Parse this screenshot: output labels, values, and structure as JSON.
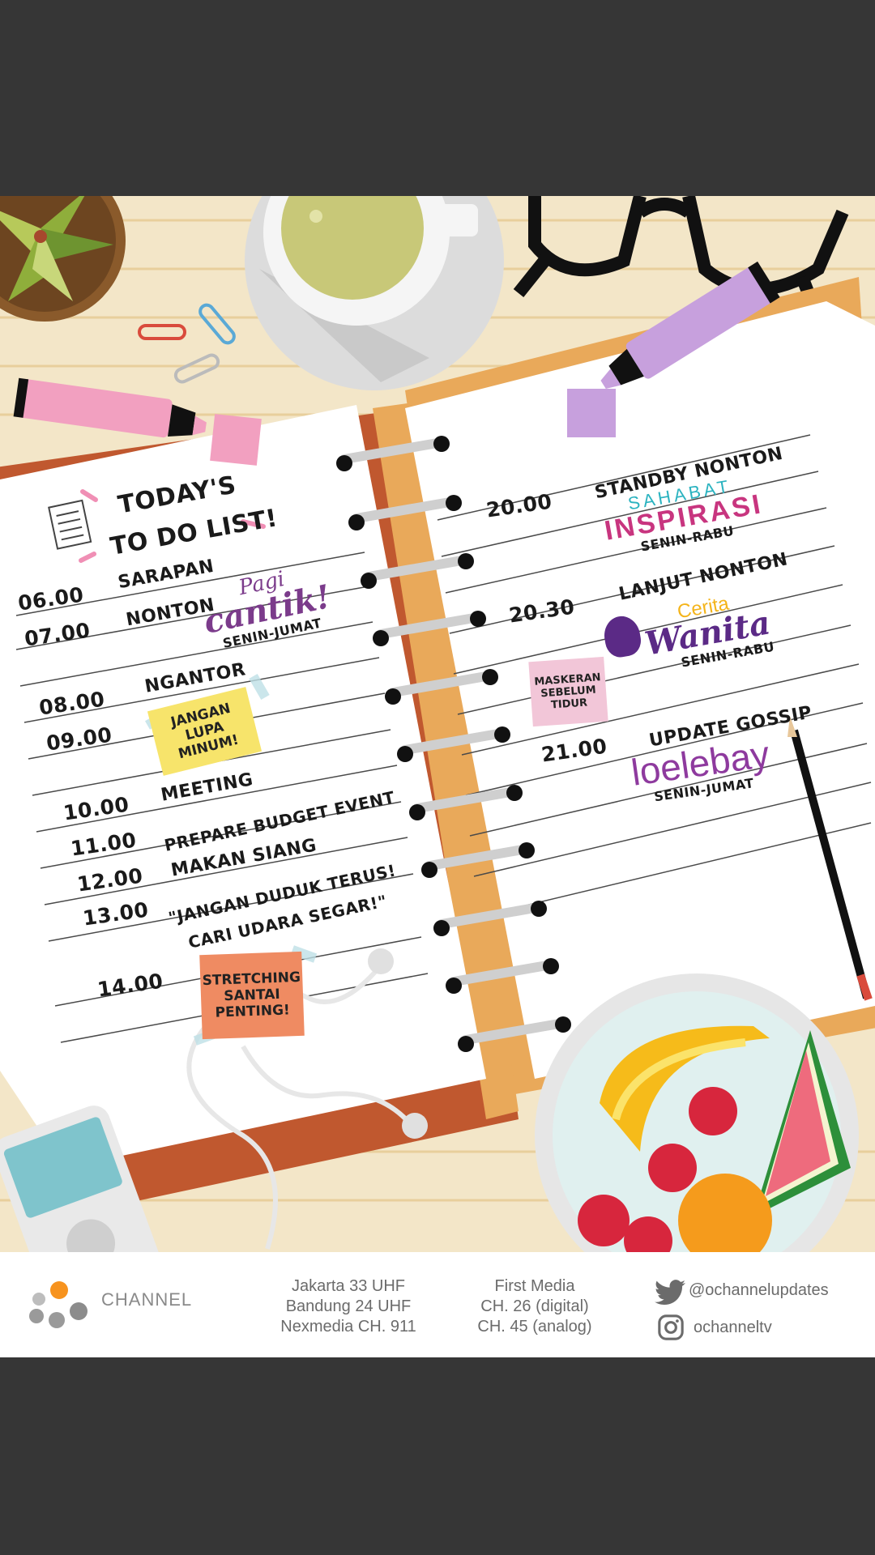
{
  "left_page": {
    "title_line1": "TODAY'S",
    "title_line2": "TO DO LIST!",
    "entries": [
      {
        "time": "06.00",
        "task": "SARAPAN"
      },
      {
        "time": "07.00",
        "task": "NONTON"
      },
      {
        "time": "08.00",
        "task": "NGANTOR"
      },
      {
        "time": "09.00",
        "task": ""
      },
      {
        "time": "10.00",
        "task": "MEETING"
      },
      {
        "time": "11.00",
        "task": "PREPARE BUDGET EVENT"
      },
      {
        "time": "12.00",
        "task": "MAKAN SIANG"
      },
      {
        "time": "13.00",
        "task": "\"JANGAN DUDUK TERUS!"
      },
      {
        "time": "",
        "task": "CARI UDARA SEGAR!\""
      },
      {
        "time": "14.00",
        "task": ""
      }
    ],
    "show_pagi_cantik": {
      "line1": "Pagi",
      "line2": "cantik!",
      "schedule": "SENIN-JUMAT"
    },
    "sticky_yellow": "JANGAN LUPA\nMINUM!",
    "sticky_orange": "STRETCHING\nSANTAI\nPENTING!"
  },
  "right_page": {
    "entries": [
      {
        "time": "20.00",
        "task": "STANDBY NONTON"
      },
      {
        "time": "20.30",
        "task": "LANJUT NONTON"
      },
      {
        "time": "21.00",
        "task": "UPDATE GOSSIP"
      }
    ],
    "show_sahabat": {
      "line1": "SAHABAT",
      "line2": "INSPIRASI",
      "schedule": "SENIN-RABU"
    },
    "show_cerita": {
      "line1": "Cerita",
      "line2": "Wanita",
      "schedule": "SENIN-RABU"
    },
    "show_loelebay": {
      "name": "loelebay",
      "schedule": "SENIN-JUMAT"
    },
    "sticky_pink": "MASKERAN\nSEBELUM\nTIDUR"
  },
  "footer": {
    "logo_text": "CHANNEL",
    "terrestrial": [
      "Jakarta 33 UHF",
      "Bandung 24 UHF",
      "Nexmedia CH. 911"
    ],
    "cable": [
      "First Media",
      "CH. 26 (digital)",
      "CH. 45 (analog)"
    ],
    "twitter": "@ochannelupdates",
    "instagram": "ochanneltv"
  },
  "colors": {
    "desk": "#f3e6c8",
    "binder": "#c0582f",
    "binder_inner": "#e9a95a",
    "sticky_yellow": "#f7e46b",
    "sticky_orange": "#ef8b62",
    "sticky_pink": "#f2c6d8",
    "brand_orange": "#f7931e"
  }
}
